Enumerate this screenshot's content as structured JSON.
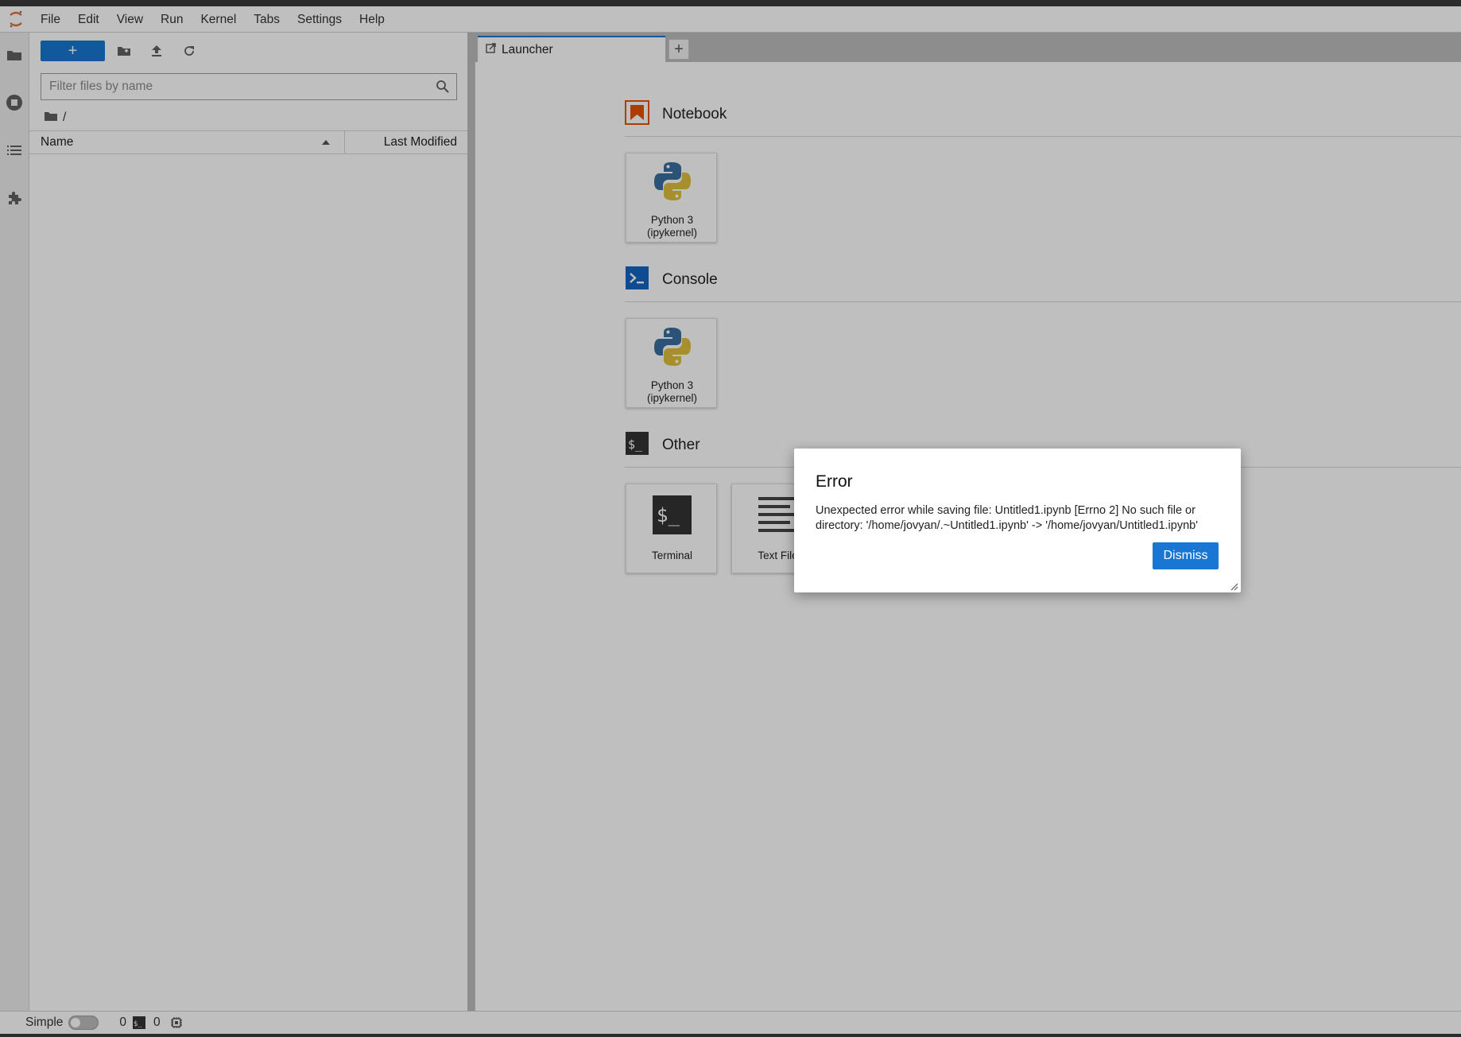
{
  "menubar": {
    "items": [
      "File",
      "Edit",
      "View",
      "Run",
      "Kernel",
      "Tabs",
      "Settings",
      "Help"
    ]
  },
  "activity": {
    "icons": [
      "folder-icon",
      "running-stop-icon",
      "table-of-contents-icon",
      "extension-puzzle-icon"
    ]
  },
  "filebrowser": {
    "new_button_label": "+",
    "filter_placeholder": "Filter files by name",
    "filter_value": "",
    "breadcrumb": "/",
    "columns": {
      "name": "Name",
      "modified": "Last Modified"
    },
    "sort": "name-ascending"
  },
  "tabs": {
    "items": [
      {
        "label": "Launcher",
        "active": true
      }
    ],
    "add_label": "+"
  },
  "launcher": {
    "sections": [
      {
        "title": "Notebook",
        "cards": [
          {
            "line1": "Python 3",
            "line2": "(ipykernel)",
            "icon": "python-logo-icon"
          }
        ]
      },
      {
        "title": "Console",
        "cards": [
          {
            "line1": "Python 3",
            "line2": "(ipykernel)",
            "icon": "python-logo-icon"
          }
        ]
      },
      {
        "title": "Other",
        "cards": [
          {
            "line1": "Terminal",
            "icon": "terminal-icon"
          },
          {
            "line1": "Text File",
            "icon": "text-file-icon"
          }
        ]
      }
    ]
  },
  "dialog": {
    "title": "Error",
    "message": "Unexpected error while saving file: Untitled1.ipynb [Errno 2] No such file or directory: '/home/jovyan/.~Untitled1.ipynb' -> '/home/jovyan/Untitled1.ipynb'",
    "dismiss_label": "Dismiss"
  },
  "statusbar": {
    "mode_label": "Simple",
    "simple_mode_on": false,
    "kernels_count": "0",
    "terminals_count": "0"
  },
  "colors": {
    "accent": "#1976d2",
    "notebook_icon": "#e65100",
    "console_icon": "#1565c0",
    "terminal_icon": "#333333"
  }
}
